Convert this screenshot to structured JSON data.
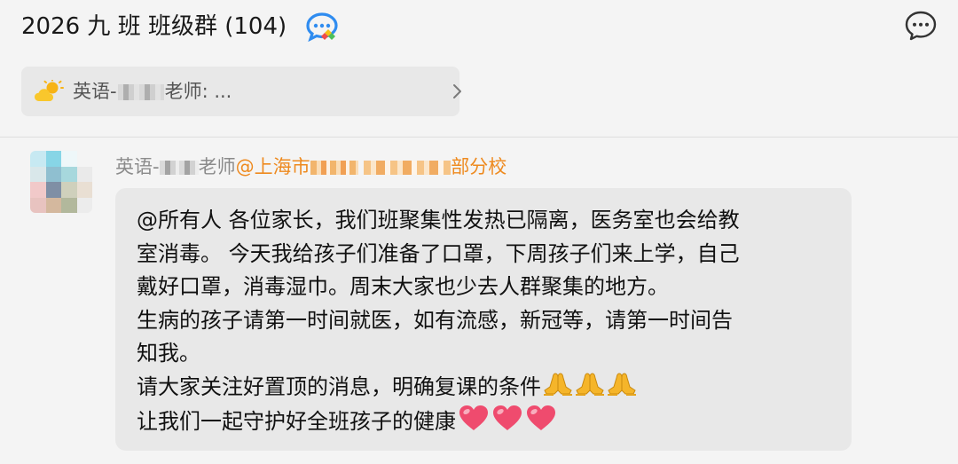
{
  "header": {
    "title": "2026 九  班 班级群 (104)",
    "badge_icon": "multicolor-chat-bubble-icon",
    "more_icon": "chat-bubble-ellipsis-icon"
  },
  "pinned_message": {
    "icon": "sun-cloud-icon",
    "prefix": "英语-",
    "suffix": "老师: ...",
    "chevron_icon": "chevron-right-icon"
  },
  "message": {
    "sender": {
      "name_prefix": "英语-",
      "name_suffix": "老师",
      "org_prefix": "@上海市",
      "org_suffix": "部分校"
    },
    "lines": [
      "@所有人 各位家长，我们班聚集性发热已隔离，医务室也会给教",
      "室消毒。 今天我给孩子们准备了口罩，下周孩子们来上学，自己",
      "戴好口罩，消毒湿巾。周末大家也少去人群聚集的地方。",
      "生病的孩子请第一时间就医，如有流感，新冠等，请第一时间告",
      "知我。",
      "请大家关注好置顶的消息，明确复课的条件",
      "让我们一起守护好全班孩子的健康"
    ],
    "emoji": {
      "praying_hands": 3,
      "hearts": 3,
      "praying_icon": "praying-hands-icon",
      "heart_icon": "heart-icon"
    }
  },
  "colors": {
    "background": "#f4f4f4",
    "bubble": "#e8e8e8",
    "org_text": "#ee8a1f",
    "secondary_text": "#8b8b8b",
    "heart": "#ef4b6e",
    "praying_hands": "#f5b52a"
  }
}
